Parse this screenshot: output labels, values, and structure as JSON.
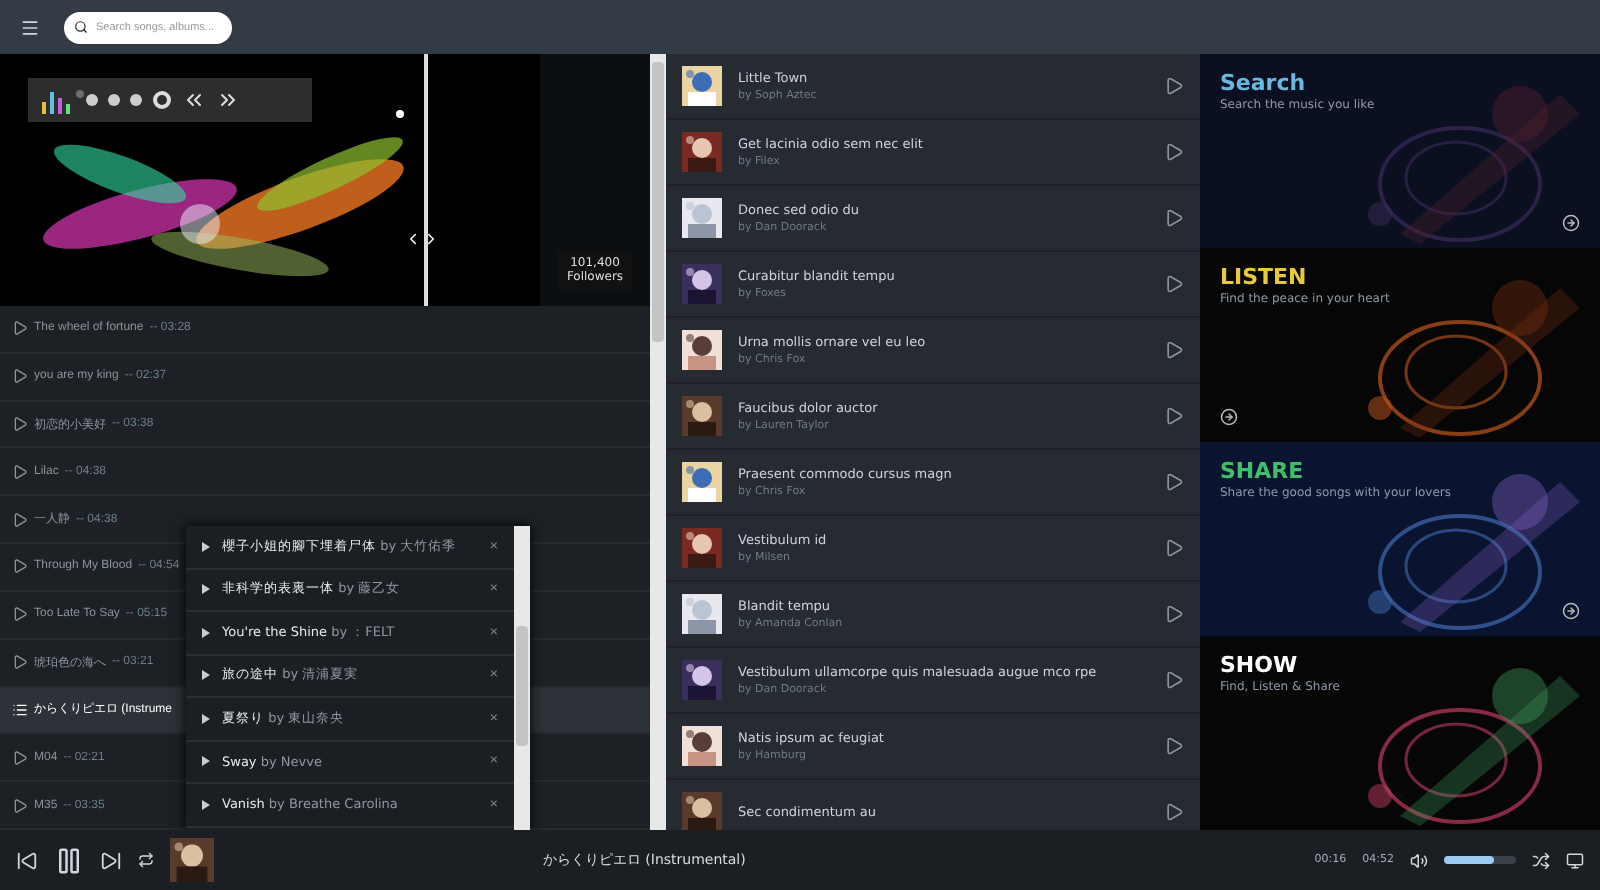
{
  "topbar": {
    "search": {
      "placeholder": "Search songs, albums..."
    }
  },
  "hero": {
    "followers_count": "101,400",
    "followers_label": "Followers"
  },
  "songs": [
    {
      "title": "The wheel of fortune",
      "duration": "-- 03:28",
      "selected": false
    },
    {
      "title": "you are my king",
      "duration": "-- 02:37",
      "selected": false
    },
    {
      "title": "初恋的小美好",
      "duration": "-- 03:38",
      "selected": false
    },
    {
      "title": "Lilac",
      "duration": "-- 04:38",
      "selected": false
    },
    {
      "title": "一人静",
      "duration": "-- 04:38",
      "selected": false
    },
    {
      "title": "Through My Blood",
      "duration": "-- 04:54",
      "selected": false
    },
    {
      "title": "Too Late To Say",
      "duration": "-- 05:15",
      "selected": false
    },
    {
      "title": "琥珀色の海へ",
      "duration": "-- 03:21",
      "selected": false
    },
    {
      "title": "からくりピエロ (Instrume",
      "selected": true
    },
    {
      "title": "M04",
      "duration": "-- 02:21",
      "selected": false
    },
    {
      "title": "M35",
      "duration": "-- 03:35",
      "selected": false
    }
  ],
  "queue": [
    {
      "text": "**櫻子小姐的腳下埋着尸体** by 大竹佑季",
      "close": "×"
    },
    {
      "text": "**非科学的表裏一体** by 藤乙女",
      "close": "×"
    },
    {
      "text": "**You're the Shine** by ：FELT",
      "close": "×"
    },
    {
      "text": "**旅の途中** by 清浦夏実",
      "close": "×"
    },
    {
      "text": "**夏祭り** by 東山奈央",
      "close": "×"
    },
    {
      "text": "**Sway** by Nevve",
      "close": "×"
    },
    {
      "text": "**Vanish** by Breathe Carolina",
      "close": "×"
    }
  ],
  "tracks": [
    {
      "title": "Little Town",
      "artist": "by Soph Aztec"
    },
    {
      "title": "Get lacinia odio sem nec elit",
      "artist": "by Filex"
    },
    {
      "title": "Donec sed odio du",
      "artist": "by Dan Doorack"
    },
    {
      "title": "Curabitur blandit tempu",
      "artist": "by Foxes"
    },
    {
      "title": "Urna mollis ornare vel eu leo",
      "artist": "by Chris Fox"
    },
    {
      "title": "Faucibus dolor auctor",
      "artist": "by Lauren Taylor"
    },
    {
      "title": "Praesent commodo cursus magn",
      "artist": "by Chris Fox"
    },
    {
      "title": "Vestibulum id",
      "artist": "by Milsen"
    },
    {
      "title": "Blandit tempu",
      "artist": "by Amanda Conlan"
    },
    {
      "title": "Vestibulum ullamcorpe quis malesuada augue mco rpe",
      "artist": "by Dan Doorack"
    },
    {
      "title": "Natis ipsum ac feugiat",
      "artist": "by Hamburg"
    },
    {
      "title": "Sec condimentum au"
    }
  ],
  "features": [
    {
      "title": "Search",
      "subtitle": "Search the music you like",
      "color": "#6ab7e0",
      "arrow": true
    },
    {
      "title": "LISTEN",
      "subtitle": "Find the peace in your heart",
      "color": "#e8c93e",
      "arrow": true
    },
    {
      "title": "SHARE",
      "subtitle": "Share the good songs with your lovers",
      "color": "#3fbf6a",
      "arrow": true
    },
    {
      "title": "SHOW",
      "subtitle": "Find, Listen & Share",
      "color": "#ffffff",
      "arrow": false
    }
  ],
  "player": {
    "playing": true,
    "title": "からくりピエロ (Instrumental)",
    "elapsed": "00:16",
    "total": "04:52",
    "volume": {
      "level": 0.7
    }
  }
}
